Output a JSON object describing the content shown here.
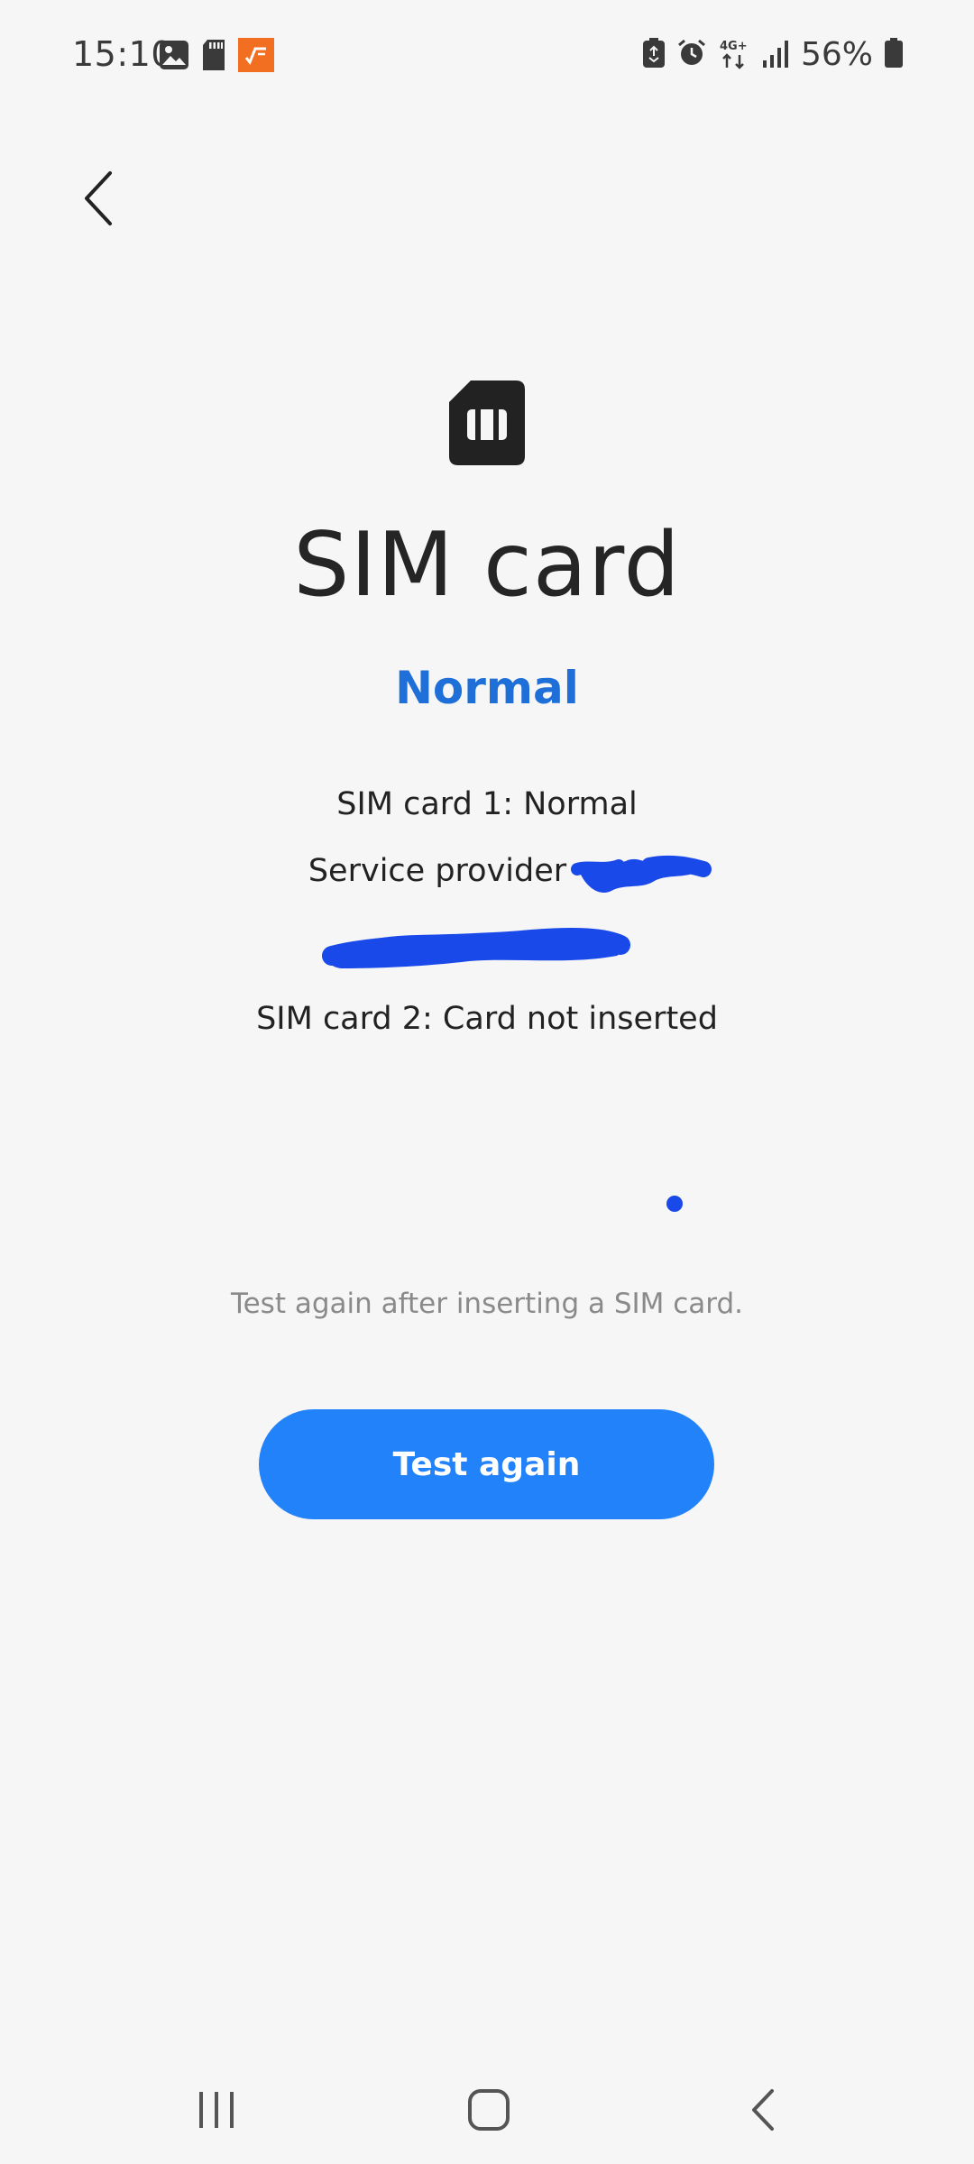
{
  "status_bar": {
    "time": "15:10",
    "left_icons": [
      "image-icon",
      "sd-card-icon",
      "app-notification-icon"
    ],
    "right_icons": [
      "battery-saver-icon",
      "alarm-icon",
      "network-4g-icon",
      "signal-icon"
    ],
    "network_type": "4G+",
    "battery_percent": "56%"
  },
  "header": {
    "back_icon": "chevron-left-icon"
  },
  "main": {
    "icon": "sim-card-icon",
    "title": "SIM card",
    "result": "Normal",
    "sim1_status": "SIM card 1: Normal",
    "service_provider_label": "Service provider",
    "sim2_status": "SIM card 2: Card not inserted",
    "hint": "Test again after inserting a SIM card.",
    "button_label": "Test again"
  },
  "colors": {
    "accent_text": "#1f6fd8",
    "button": "#2282f9",
    "redaction": "#1a49ea",
    "background": "#f6f6f6"
  },
  "nav_bar": {
    "icons": [
      "recents-icon",
      "home-icon",
      "back-icon"
    ]
  }
}
